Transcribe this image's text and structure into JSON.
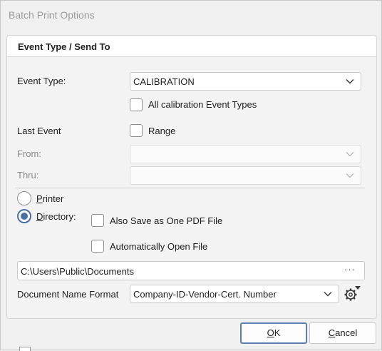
{
  "window": {
    "title": "Batch Print Options"
  },
  "group": {
    "header": "Event Type / Send To"
  },
  "event_type": {
    "label": "Event Type:",
    "value": "CALIBRATION",
    "all_types_label": "All calibration Event Types",
    "all_types_checked": false
  },
  "last_event": {
    "label": "Last Event",
    "range_label": "Range",
    "range_checked": false,
    "from_label": "From:",
    "thru_label": "Thru:",
    "from_value": "",
    "thru_value": ""
  },
  "destination": {
    "printer_first": "P",
    "printer_rest": "rinter",
    "printer_selected": false,
    "directory_first": "D",
    "directory_rest": "irectory:",
    "directory_selected": true,
    "save_pdf_label": "Also Save as One PDF File",
    "save_pdf_checked": false,
    "auto_open_label": "Automatically Open File",
    "auto_open_checked": false,
    "path": "C:\\Users\\Public\\Documents",
    "browse_label": "···"
  },
  "doc_name": {
    "label": "Document Name Format",
    "value": "Company-ID-Vendor-Cert. Number"
  },
  "buttons": {
    "ok_first": "O",
    "ok_rest": "K",
    "cancel_first": "C",
    "cancel_rest": "ancel"
  }
}
